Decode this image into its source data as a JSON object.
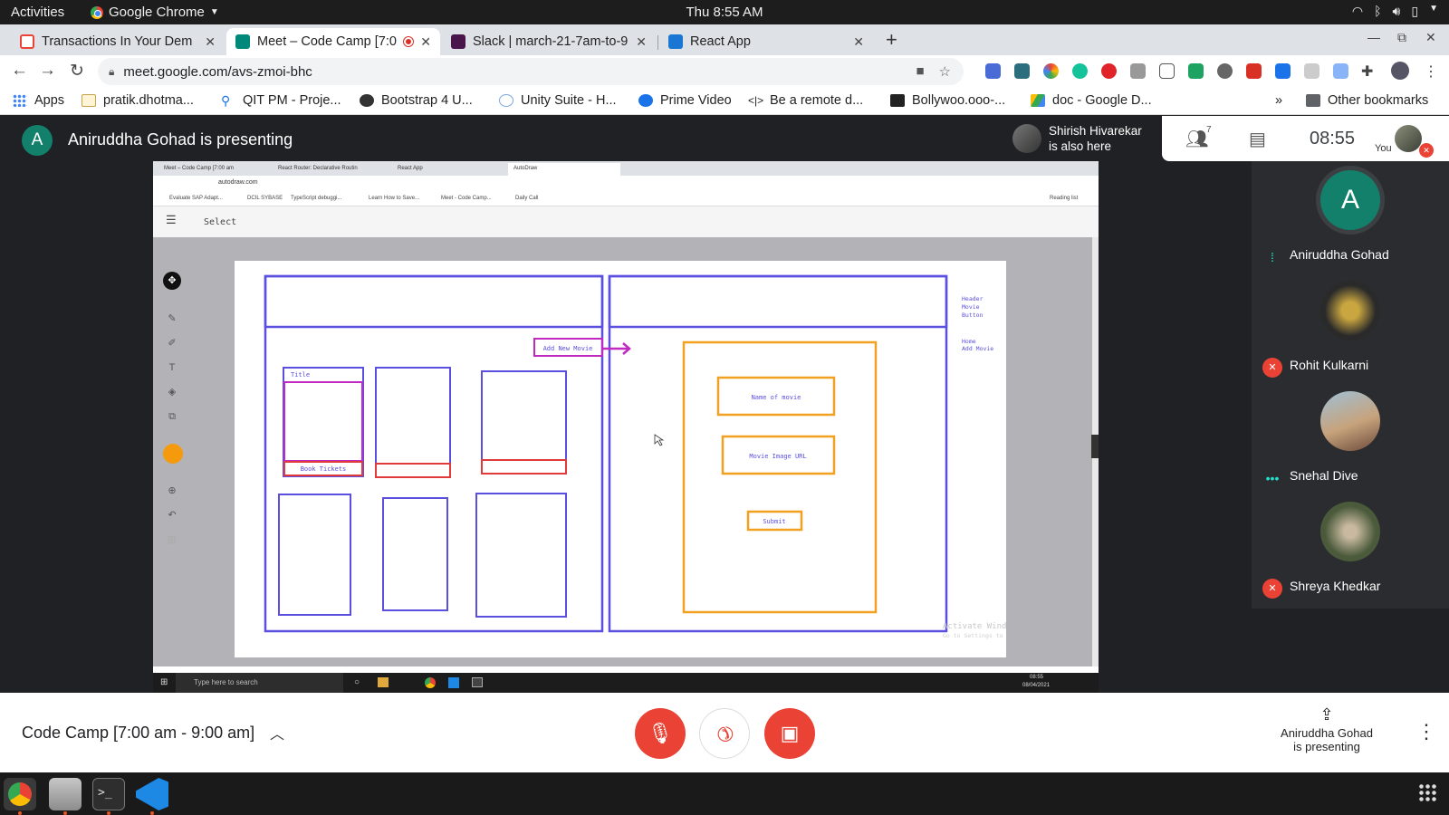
{
  "system_bar": {
    "activities": "Activities",
    "app_name": "Google Chrome",
    "clock": "Thu  8:55 AM"
  },
  "tabs": [
    {
      "title": "Transactions In Your Dem",
      "favicon_color": "#ea4335"
    },
    {
      "title": "Meet – Code Camp [7:0",
      "favicon_color": "#00897b"
    },
    {
      "title": "Slack | march-21-7am-to-9",
      "favicon_color": "#4a154b"
    },
    {
      "title": "React App",
      "favicon_color": "#1976d2"
    }
  ],
  "address_bar": {
    "url": "meet.google.com/avs-zmoi-bhc"
  },
  "bookmarks": {
    "items": [
      "Apps",
      "pratik.dhotma...",
      "QIT PM - Proje...",
      "Bootstrap 4 U...",
      "Unity Suite - H...",
      "Prime Video",
      "Be a remote d...",
      "Bollywoo.ooo-...",
      "doc - Google D..."
    ],
    "other": "Other bookmarks",
    "overflow": "»"
  },
  "meet_header": {
    "presenter_initial": "A",
    "presenting_title": "Aniruddha Gohad is presenting",
    "also_here": "Shirish Hivarekar is also here",
    "people_count": "7",
    "time": "08:55",
    "you_label": "You"
  },
  "shared_screen": {
    "remote_tabs": [
      "Meet – Code Camp [7:00 am",
      "React Router: Declarative Routin",
      "React App",
      "AutoDraw"
    ],
    "remote_url": "autodraw.com",
    "remote_bookmarks": [
      "Evaluate SAP Adapt...",
      "DCIL SYBASE",
      "TypeScript debuggi...",
      "Learn How to Save...",
      "Meet - Code Camp...",
      "Daily Call"
    ],
    "reading_list": "Reading list",
    "autodraw_select": "Select",
    "wireframe": {
      "add_new_movie": "Add New Movie",
      "title": "Title",
      "book_tickets": "Book Tickets",
      "name_of_movie": "Name of movie",
      "movie_image_url": "Movie Image URL",
      "submit": "Submit",
      "notes_top": [
        "Header",
        "Movie",
        "Button"
      ],
      "notes_bottom": [
        "Home",
        "Add Movie"
      ],
      "watermark_line1": "Activate Windows",
      "watermark_line2": "Go to Settings to activate Windows."
    },
    "win_search": "Type here to search",
    "win_time": "08:55",
    "win_date": "08/04/2021"
  },
  "participants": [
    {
      "name": "Aniruddha Gohad",
      "initial": "A",
      "status": "speaking",
      "avatar_color": "#12806b"
    },
    {
      "name": "Rohit Kulkarni",
      "status": "muted",
      "avatar_color": "#2a2a2a"
    },
    {
      "name": "Snehal Dive",
      "status": "more",
      "avatar_color": "#c7a37c"
    },
    {
      "name": "Shreya Khedkar",
      "status": "muted",
      "avatar_color": "#4a5a3a"
    }
  ],
  "controls": {
    "meeting_name": "Code Camp [7:00 am - 9:00 am]",
    "presenting_line1": "Aniruddha Gohad",
    "presenting_line2": "is presenting"
  },
  "colors": {
    "danger": "#ea4335",
    "meet_bg": "#202124",
    "accent_teal": "#12806b"
  }
}
